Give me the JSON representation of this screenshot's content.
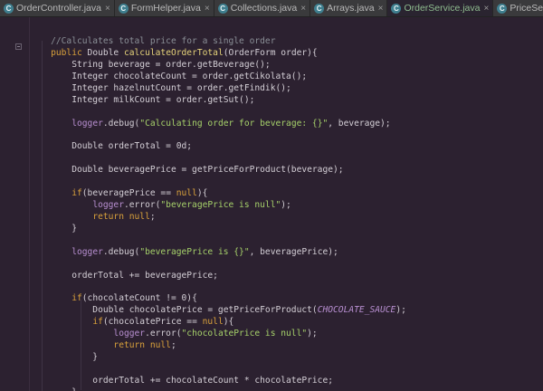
{
  "tabs": [
    {
      "label": "OrderController.java",
      "icon": "java-class-icon",
      "active": false,
      "italic": false
    },
    {
      "label": "FormHelper.java",
      "icon": "java-class-icon",
      "active": false,
      "italic": false
    },
    {
      "label": "Collections.java",
      "icon": "java-class-icon",
      "active": false,
      "italic": false
    },
    {
      "label": "Arrays.java",
      "icon": "java-class-icon",
      "active": false,
      "italic": false
    },
    {
      "label": "OrderService.java",
      "icon": "java-class-icon",
      "active": true,
      "italic": false
    },
    {
      "label": "PriceService.java",
      "icon": "java-class-icon",
      "active": false,
      "italic": false
    }
  ],
  "tab_close_glyph": "×",
  "tab_icon_letter": "C",
  "colors": {
    "background": "#2c2130",
    "keyword": "#d9a13b",
    "method_decl": "#e6d37a",
    "string": "#a6d16a",
    "field": "#b88fd1",
    "comment": "#8a8f96",
    "plain": "#d4cfd6"
  },
  "code": [
    [
      {
        "t": "    //Calculates total price for a single order",
        "c": "comment"
      }
    ],
    [
      {
        "t": "    ",
        "c": "plain"
      },
      {
        "t": "public",
        "c": "kw"
      },
      {
        "t": " Double ",
        "c": "plain"
      },
      {
        "t": "calculateOrderTotal",
        "c": "fn"
      },
      {
        "t": "(OrderForm order){",
        "c": "plain"
      }
    ],
    [
      {
        "t": "        String beverage = order.getBeverage();",
        "c": "plain"
      }
    ],
    [
      {
        "t": "        Integer chocolateCount = order.getCikolata();",
        "c": "plain"
      }
    ],
    [
      {
        "t": "        Integer hazelnutCount = order.getFindik();",
        "c": "plain"
      }
    ],
    [
      {
        "t": "        Integer milkCount = order.getSut();",
        "c": "plain"
      }
    ],
    [],
    [
      {
        "t": "        ",
        "c": "plain"
      },
      {
        "t": "logger",
        "c": "field"
      },
      {
        "t": ".debug(",
        "c": "plain"
      },
      {
        "t": "\"Calculating order for beverage: {}\"",
        "c": "str"
      },
      {
        "t": ", beverage);",
        "c": "plain"
      }
    ],
    [],
    [
      {
        "t": "        Double orderTotal = 0d;",
        "c": "plain"
      }
    ],
    [],
    [
      {
        "t": "        Double beveragePrice = getPriceForProduct(beverage);",
        "c": "plain"
      }
    ],
    [],
    [
      {
        "t": "        ",
        "c": "plain"
      },
      {
        "t": "if",
        "c": "kw"
      },
      {
        "t": "(beveragePrice == ",
        "c": "plain"
      },
      {
        "t": "null",
        "c": "kw"
      },
      {
        "t": "){",
        "c": "plain"
      }
    ],
    [
      {
        "t": "            ",
        "c": "plain"
      },
      {
        "t": "logger",
        "c": "field"
      },
      {
        "t": ".error(",
        "c": "plain"
      },
      {
        "t": "\"beveragePrice is null\"",
        "c": "str"
      },
      {
        "t": ");",
        "c": "plain"
      }
    ],
    [
      {
        "t": "            ",
        "c": "plain"
      },
      {
        "t": "return null",
        "c": "kw"
      },
      {
        "t": ";",
        "c": "plain"
      }
    ],
    [
      {
        "t": "        }",
        "c": "plain"
      }
    ],
    [],
    [
      {
        "t": "        ",
        "c": "plain"
      },
      {
        "t": "logger",
        "c": "field"
      },
      {
        "t": ".debug(",
        "c": "plain"
      },
      {
        "t": "\"beveragePrice is {}\"",
        "c": "str"
      },
      {
        "t": ", beveragePrice);",
        "c": "plain"
      }
    ],
    [],
    [
      {
        "t": "        orderTotal += beveragePrice;",
        "c": "plain"
      }
    ],
    [],
    [
      {
        "t": "        ",
        "c": "plain"
      },
      {
        "t": "if",
        "c": "kw"
      },
      {
        "t": "(chocolateCount != 0){",
        "c": "plain"
      }
    ],
    [
      {
        "t": "            Double chocolatePrice = getPriceForProduct(",
        "c": "plain"
      },
      {
        "t": "CHOCOLATE_SAUCE",
        "c": "const"
      },
      {
        "t": ");",
        "c": "plain"
      }
    ],
    [
      {
        "t": "            ",
        "c": "plain"
      },
      {
        "t": "if",
        "c": "kw"
      },
      {
        "t": "(chocolatePrice == ",
        "c": "plain"
      },
      {
        "t": "null",
        "c": "kw"
      },
      {
        "t": "){",
        "c": "plain"
      }
    ],
    [
      {
        "t": "                ",
        "c": "plain"
      },
      {
        "t": "logger",
        "c": "field"
      },
      {
        "t": ".error(",
        "c": "plain"
      },
      {
        "t": "\"chocolatePrice is null\"",
        "c": "str"
      },
      {
        "t": ");",
        "c": "plain"
      }
    ],
    [
      {
        "t": "                ",
        "c": "plain"
      },
      {
        "t": "return null",
        "c": "kw"
      },
      {
        "t": ";",
        "c": "plain"
      }
    ],
    [
      {
        "t": "            }",
        "c": "plain"
      }
    ],
    [],
    [
      {
        "t": "            orderTotal += chocolateCount * chocolatePrice;",
        "c": "plain"
      }
    ],
    [
      {
        "t": "        }",
        "c": "plain"
      }
    ]
  ]
}
